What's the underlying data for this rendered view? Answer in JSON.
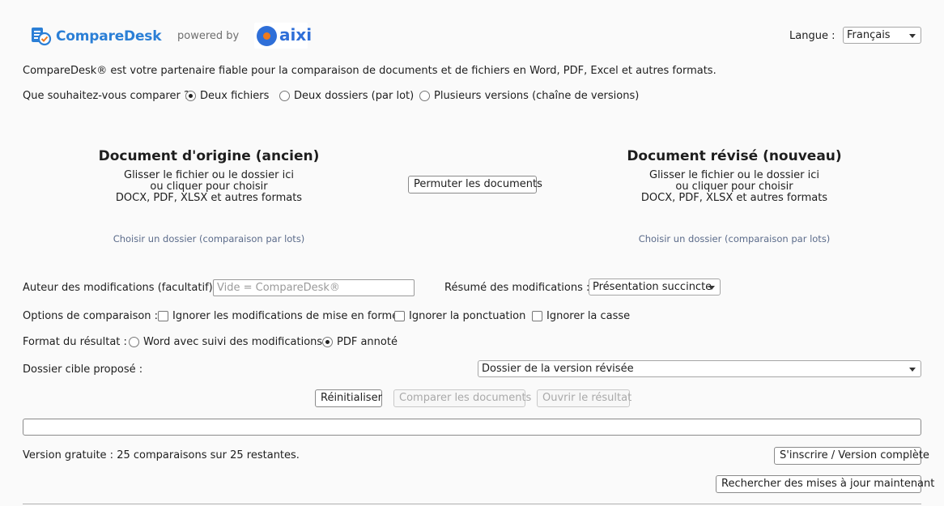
{
  "header": {
    "logo": {
      "part1": "Compare",
      "part2": "Desk"
    },
    "powered_by": "powered by",
    "partner_logo": "aixi",
    "language_label": "Langue :",
    "language_value": "Français"
  },
  "tagline": "CompareDesk® est votre partenaire fiable pour la comparaison de documents et de fichiers en Word, PDF, Excel et autres formats.",
  "compare_mode": {
    "question": "Que souhaitez-vous comparer ?",
    "options": [
      "Deux fichiers",
      "Deux dossiers (par lot)",
      "Plusieurs versions (chaîne de versions)"
    ],
    "selected": 0
  },
  "original": {
    "title": "Document d'origine (ancien)",
    "line1": "Glisser le fichier ou le dossier ici",
    "line2": "ou cliquer pour choisir",
    "line3": "DOCX, PDF, XLSX et autres formats",
    "folder_link": "Choisir un dossier (comparaison par lots)"
  },
  "revised": {
    "title": "Document révisé (nouveau)",
    "line1": "Glisser le fichier ou le dossier ici",
    "line2": "ou cliquer pour choisir",
    "line3": "DOCX, PDF, XLSX et autres formats",
    "folder_link": "Choisir un dossier (comparaison par lots)"
  },
  "swap_button": "Permuter les documents",
  "author": {
    "label": "Auteur des modifications (facultatif) :",
    "placeholder": "Vide = CompareDesk®"
  },
  "summary": {
    "label": "Résumé des modifications :",
    "value": "Présentation succincte"
  },
  "options": {
    "label": "Options de comparaison :",
    "items": [
      "Ignorer les modifications de mise en forme",
      "Ignorer la ponctuation",
      "Ignorer la casse"
    ]
  },
  "output_format": {
    "label": "Format du résultat :",
    "options": [
      "Word avec suivi des modifications",
      "PDF annoté"
    ],
    "selected": 1
  },
  "target_folder": {
    "label": "Dossier cible proposé :",
    "value": "Dossier de la version révisée"
  },
  "actions": {
    "reset": "Réinitialiser",
    "compare": "Comparer les documents",
    "open_result": "Ouvrir le résultat"
  },
  "status": "Version gratuite : 25 comparaisons sur 25 restantes.",
  "signup_button": "S'inscrire / Version complète",
  "update_button": "Rechercher des mises à jour maintenant",
  "colors": {
    "brand_blue": "#2b7fd6",
    "brand_orange": "#f07a1c",
    "link_gray": "#5b6b8a"
  }
}
